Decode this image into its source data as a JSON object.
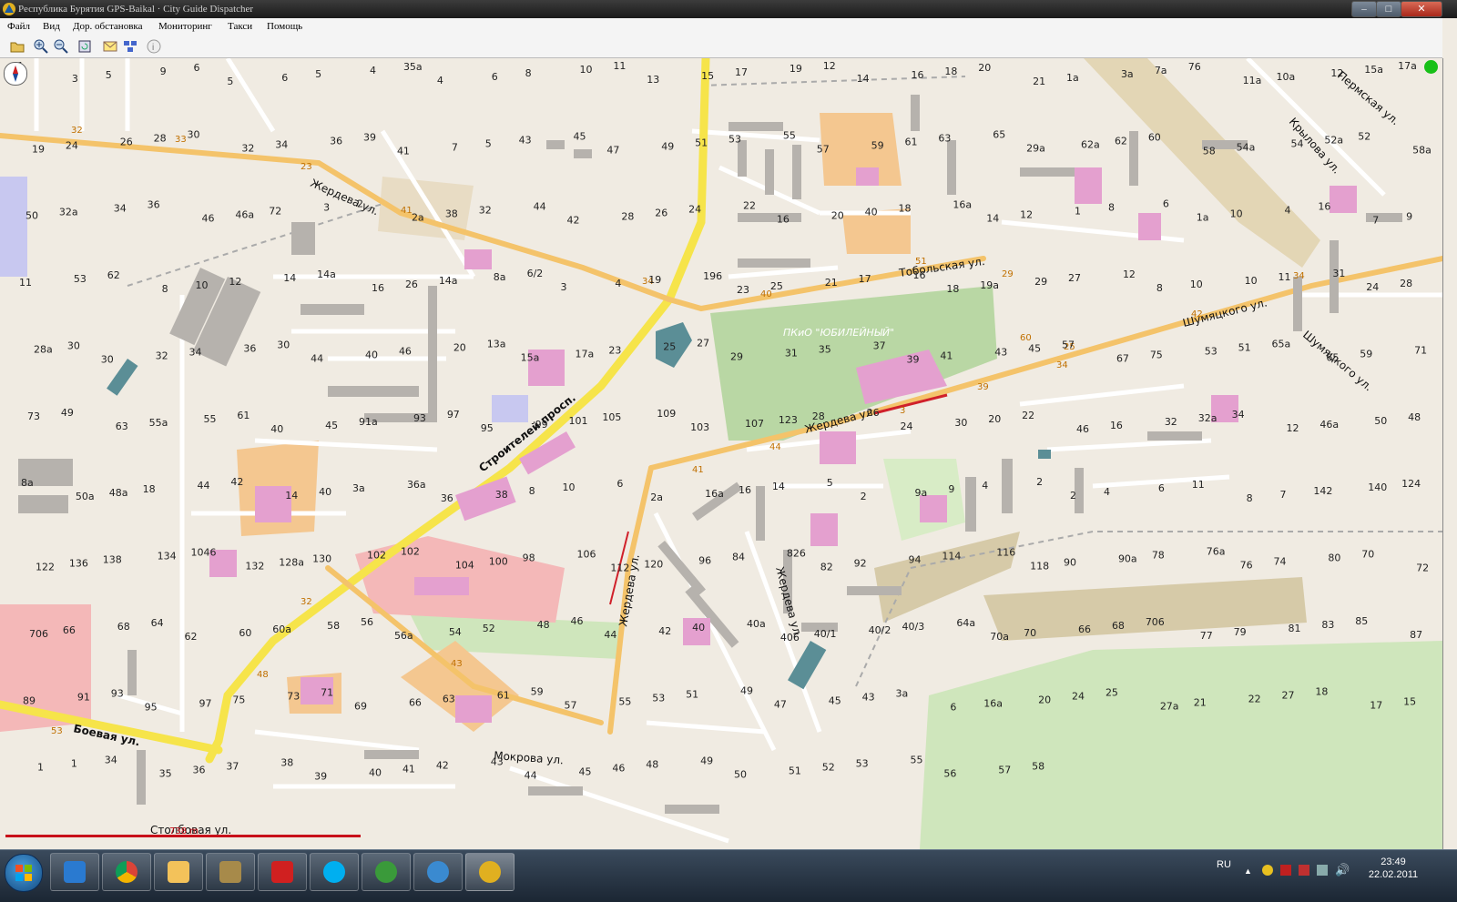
{
  "window": {
    "title": "Республика Бурятия GPS-Baikal · City Guide Dispatcher"
  },
  "menu": [
    "Файл",
    "Вид",
    "Дор. обстановка",
    "Мониторинг",
    "Такси",
    "Помощь"
  ],
  "toolbar": [
    "open-icon",
    "zoom-in-icon",
    "zoom-out-icon",
    "refresh-icon",
    "message-icon",
    "network-icon",
    "info-icon"
  ],
  "map": {
    "streets": {
      "zherdeva_top": "Жердева ул.",
      "stroiteley": "Строителей просп.",
      "tobolskaya": "Тобольская ул.",
      "shumyatskogo": "Шумяцкого ул.",
      "shumyatskogo2": "Шумяцкого ул.",
      "zherdeva_mid": "Жердева ул.",
      "zherdeva_v1": "Жердева ул.",
      "zherdeva_v2": "Жердева ул.",
      "boevaya": "Боевая ул.",
      "mokrova": "Мокрова ул.",
      "stolbovaya": "Столбовая ул.",
      "permskaya": "Пермская ул.",
      "krylova": "Крылова ул."
    },
    "park": "ПКиО \"ЮБИЛЕЙНЫЙ\"",
    "scale_label": "738 m",
    "house_numbers": [
      "1",
      "3",
      "5",
      "9",
      "6",
      "5",
      "6",
      "5",
      "4",
      "35а",
      "4",
      "6",
      "8",
      "10",
      "11",
      "13",
      "15",
      "17",
      "19",
      "12",
      "14",
      "16",
      "18",
      "20",
      "21",
      "1а",
      "3а",
      "7а",
      "76",
      "11а",
      "10а",
      "12",
      "15а",
      "17а",
      "19",
      "24",
      "26",
      "28",
      "30",
      "32",
      "34",
      "36",
      "39",
      "41",
      "7",
      "5",
      "43",
      "45",
      "47",
      "49",
      "51",
      "53",
      "55",
      "57",
      "59",
      "61",
      "63",
      "65",
      "29а",
      "62а",
      "62",
      "60",
      "58",
      "54а",
      "54",
      "52а",
      "52",
      "58а",
      "50",
      "32а",
      "34",
      "36",
      "46",
      "46а",
      "72",
      "3",
      "2",
      "2а",
      "38",
      "32",
      "44",
      "42",
      "28",
      "26",
      "24",
      "22",
      "16",
      "20",
      "40",
      "18",
      "16а",
      "14",
      "12",
      "1",
      "8",
      "6",
      "1а",
      "10",
      "4",
      "16",
      "7",
      "9",
      "11",
      "53",
      "62",
      "8",
      "10",
      "12",
      "14",
      "14а",
      "16",
      "26",
      "14а",
      "8а",
      "6/2",
      "3",
      "4",
      "19",
      "196",
      "23",
      "25",
      "21",
      "17",
      "16",
      "18",
      "19а",
      "29",
      "27",
      "12",
      "8",
      "10",
      "10",
      "11",
      "31",
      "24",
      "28",
      "28а",
      "30",
      "30",
      "32",
      "34",
      "36",
      "30",
      "44",
      "40",
      "46",
      "20",
      "13а",
      "15а",
      "17а",
      "23",
      "25",
      "27",
      "29",
      "31",
      "35",
      "37",
      "39",
      "41",
      "43",
      "45",
      "57",
      "67",
      "75",
      "53",
      "51",
      "65а",
      "65",
      "59",
      "71",
      "73",
      "49",
      "63",
      "55а",
      "55",
      "61",
      "40",
      "45",
      "91а",
      "93",
      "97",
      "95",
      "99",
      "101",
      "105",
      "109",
      "103",
      "107",
      "123",
      "28",
      "26",
      "24",
      "30",
      "20",
      "22",
      "46",
      "16",
      "32",
      "32а",
      "34",
      "12",
      "46а",
      "50",
      "48",
      "8а",
      "50а",
      "48а",
      "18",
      "44",
      "42",
      "14",
      "40",
      "3а",
      "36а",
      "36",
      "38",
      "8",
      "10",
      "6",
      "2а",
      "16а",
      "16",
      "14",
      "5",
      "2",
      "9а",
      "9",
      "4",
      "2",
      "2",
      "4",
      "6",
      "11",
      "8",
      "7",
      "142",
      "140",
      "124",
      "122",
      "136",
      "138",
      "134",
      "1046",
      "132",
      "128а",
      "130",
      "102",
      "102",
      "104",
      "100",
      "98",
      "106",
      "112",
      "120",
      "96",
      "84",
      "826",
      "82",
      "92",
      "94",
      "114",
      "116",
      "118",
      "90",
      "90а",
      "78",
      "76а",
      "76",
      "74",
      "80",
      "70",
      "72",
      "706",
      "66",
      "68",
      "64",
      "62",
      "60",
      "60а",
      "58",
      "56",
      "56а",
      "54",
      "52",
      "48",
      "46",
      "44",
      "42",
      "40",
      "40а",
      "406",
      "40/1",
      "40/2",
      "40/3",
      "64а",
      "70а",
      "70",
      "66",
      "68",
      "706",
      "77",
      "79",
      "81",
      "83",
      "85",
      "87",
      "89",
      "91",
      "93",
      "95",
      "97",
      "75",
      "73",
      "71",
      "69",
      "66",
      "63",
      "61",
      "59",
      "57",
      "55",
      "53",
      "51",
      "49",
      "47",
      "45",
      "43",
      "3а",
      "6",
      "16а",
      "20",
      "24",
      "25",
      "27а",
      "21",
      "22",
      "27",
      "18",
      "17",
      "15",
      "1",
      "1",
      "34",
      "35",
      "36",
      "37",
      "38",
      "39",
      "40",
      "41",
      "42",
      "43",
      "44",
      "45",
      "46",
      "48",
      "49",
      "50",
      "51",
      "52",
      "53",
      "55",
      "56",
      "57",
      "58"
    ]
  },
  "taskbar": {
    "apps": [
      "ie-icon",
      "chrome-icon",
      "mail-icon",
      "explorer-icon",
      "kaspersky-icon",
      "skype-icon",
      "utorrent-icon",
      "messenger-icon",
      "navigator-icon"
    ],
    "lang": "RU",
    "time": "23:49",
    "date": "22.02.2011"
  }
}
